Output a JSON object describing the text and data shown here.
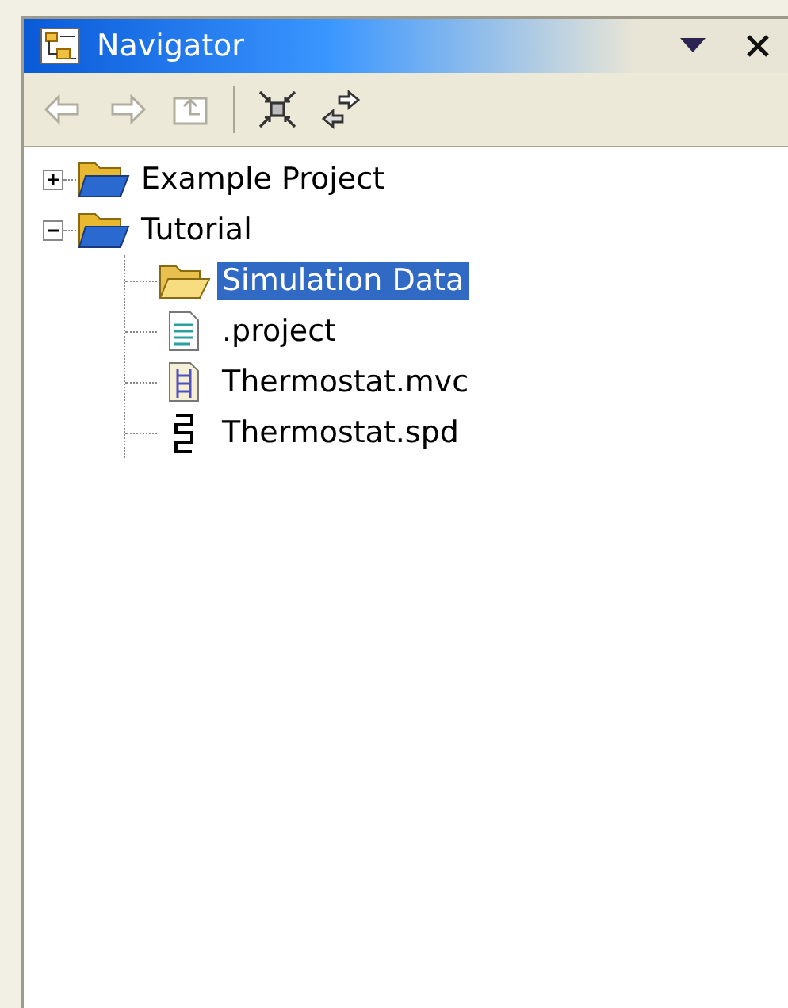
{
  "view": {
    "title": "Navigator"
  },
  "toolbar": [
    {
      "kind": "back",
      "disabled": true
    },
    {
      "kind": "forward",
      "disabled": true
    },
    {
      "kind": "up",
      "disabled": true
    },
    {
      "kind": "collapse-all",
      "disabled": false
    },
    {
      "kind": "link",
      "disabled": false
    }
  ],
  "tree": [
    {
      "label": "Example Project",
      "kind": "project",
      "expanded": false,
      "selected": false
    },
    {
      "label": "Tutorial",
      "kind": "project",
      "expanded": true,
      "selected": false,
      "children": [
        {
          "label": "Simulation Data",
          "kind": "folder",
          "selected": true
        },
        {
          "label": ".project",
          "kind": "text-file",
          "selected": false
        },
        {
          "label": "Thermostat.mvc",
          "kind": "mvc-file",
          "selected": false
        },
        {
          "label": "Thermostat.spd",
          "kind": "spd-file",
          "selected": false
        }
      ]
    }
  ]
}
